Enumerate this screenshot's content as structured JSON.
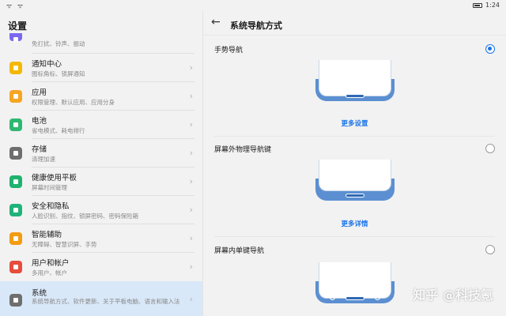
{
  "status_bar": {
    "left_icons": "ᯤ ᯤ",
    "time": "1:24"
  },
  "settings": {
    "title": "设置",
    "items": [
      {
        "title": "",
        "subtitle": "免打扰、铃声、振动",
        "icon": "sound-icon",
        "color": "#7b68ee"
      },
      {
        "title": "通知中心",
        "subtitle": "图标角标、锁屏通知",
        "icon": "bell-icon",
        "color": "#f5b800"
      },
      {
        "title": "应用",
        "subtitle": "权限管理、默认应用、应用分身",
        "icon": "apps-icon",
        "color": "#f5a623"
      },
      {
        "title": "电池",
        "subtitle": "省电模式、耗电排行",
        "icon": "battery-icon",
        "color": "#2eb872"
      },
      {
        "title": "存储",
        "subtitle": "清理加速",
        "icon": "storage-icon",
        "color": "#6e6e6e"
      },
      {
        "title": "健康使用平板",
        "subtitle": "屏幕时间管理",
        "icon": "hourglass-icon",
        "color": "#1fb26e"
      },
      {
        "title": "安全和隐私",
        "subtitle": "人脸识别、指纹、锁屏密码、密码保险箱",
        "icon": "shield-icon",
        "color": "#20b27a"
      },
      {
        "title": "智能辅助",
        "subtitle": "无障碍、智慧识屏、手势",
        "icon": "hand-icon",
        "color": "#f39c12"
      },
      {
        "title": "用户和帐户",
        "subtitle": "多用户、帐户",
        "icon": "user-icon",
        "color": "#e74c3c"
      },
      {
        "title": "系统",
        "subtitle": "系统导航方式、软件更新、关于平板电脑、语言和输入法",
        "icon": "system-icon",
        "color": "#6e6e6e"
      }
    ]
  },
  "nav_page": {
    "title": "系统导航方式",
    "options": [
      {
        "label": "手势导航",
        "selected": true,
        "link": "更多设置",
        "style": "gesture"
      },
      {
        "label": "屏幕外物理导航键",
        "selected": false,
        "link": "更多详情",
        "style": "physical"
      },
      {
        "label": "屏幕内单键导航",
        "selected": false,
        "link": "",
        "style": "single"
      }
    ]
  },
  "watermark": "知乎 @科技氪",
  "colors": {
    "accent": "#1a73e8",
    "active_bg": "#d9e8f8"
  }
}
